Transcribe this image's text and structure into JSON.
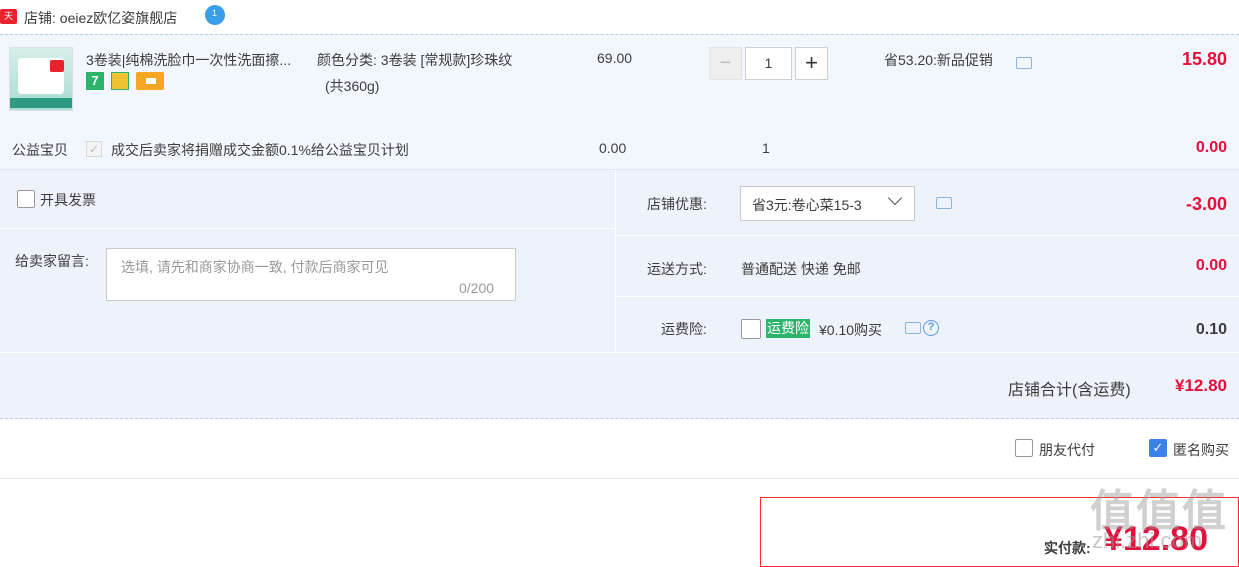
{
  "store": {
    "badge": "天猫",
    "name": "店铺: oeiez欧亿姿旗舰店"
  },
  "item": {
    "title": "3卷装|纯棉洗脸巾一次性洗面擦...",
    "badge_7": "7",
    "sku_line1": "颜色分类: 3卷装 [常规款]珍珠纹",
    "sku_line2": "(共360g)",
    "price": "69.00",
    "quantity": "1",
    "minus": "−",
    "plus": "+",
    "promo": "省53.20:新品促销",
    "subtotal": "15.80"
  },
  "charity": {
    "label": "公益宝贝",
    "check": "✓",
    "text": "成交后卖家将捐赠成交金额0.1%给公益宝贝计划",
    "price": "0.00",
    "quantity": "1",
    "subtotal": "0.00"
  },
  "options": {
    "invoice_label": "开具发票",
    "memo_label": "给卖家留言:",
    "memo_placeholder": "选填, 请先和商家协商一致, 付款后商家可见",
    "memo_count": "0/200",
    "shop_discount_label": "店铺优惠:",
    "shop_discount_value": "省3元:卷心菜15-3",
    "shop_discount_amount": "-3.00",
    "shipping_label": "运送方式:",
    "shipping_value": "普通配送 快递 免邮",
    "shipping_amount": "0.00",
    "insurance_label": "运费险:",
    "insurance_tag": "运费险",
    "insurance_price": "¥0.10购买",
    "insurance_help": "?",
    "insurance_amount": "0.10",
    "total_label": "店铺合计(含运费)",
    "total_amount": "¥12.80"
  },
  "footer": {
    "friend_pay": "朋友代付",
    "anonymous": "匿名购买",
    "anonymous_check": "✓",
    "pay_label": "实付款:",
    "pay_amount": "¥12.80"
  },
  "watermark": {
    "main": "值值值",
    "sub": "zhi.zhi.com"
  },
  "colors": {
    "accent_red": "#e40f3a",
    "panel_blue": "#eef3fb",
    "check_blue": "#3b82e8",
    "insurance_green": "#2cb56a"
  }
}
